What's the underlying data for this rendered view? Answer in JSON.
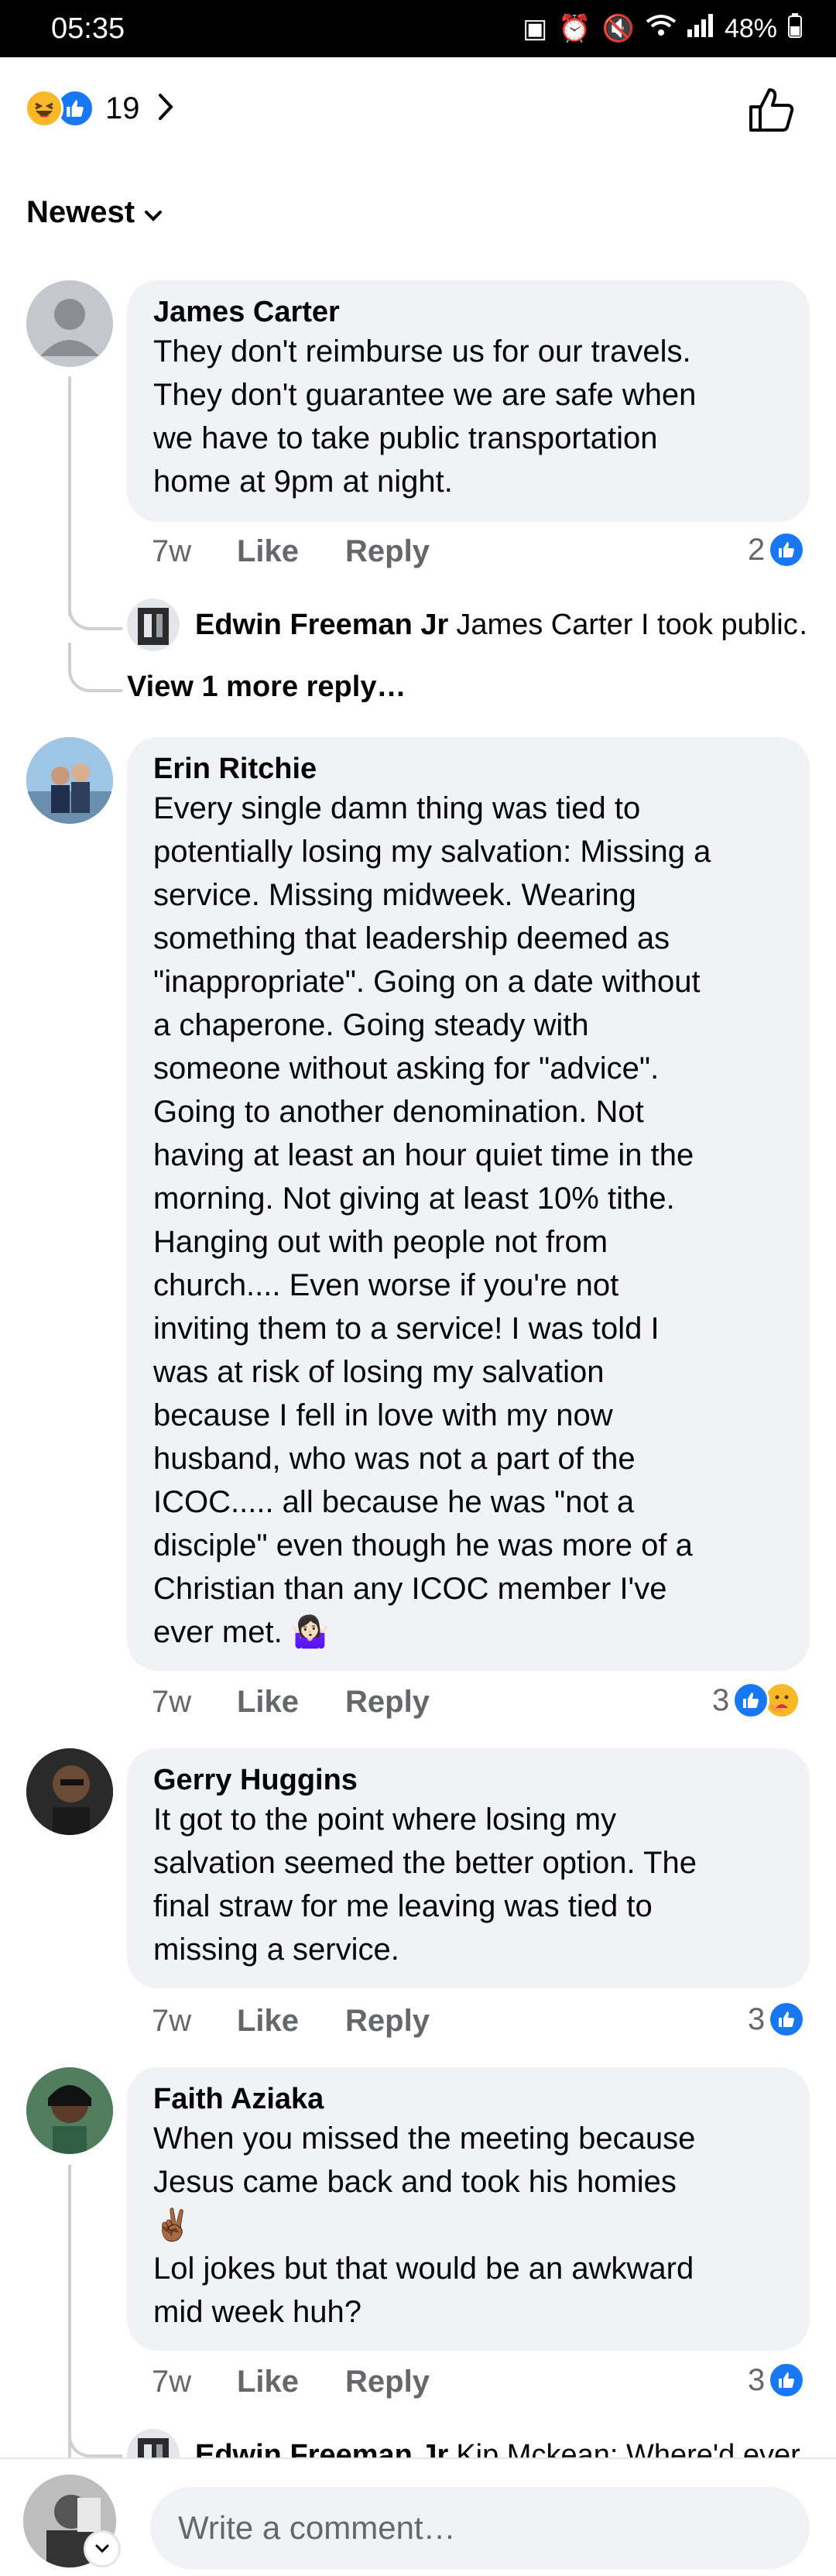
{
  "status_bar": {
    "time": "05:35",
    "battery": "48%"
  },
  "reactions_summary": {
    "count": "19"
  },
  "sort": {
    "label": "Newest"
  },
  "comments": [
    {
      "author": "James Carter",
      "text": "They don't reimburse us for our travels.\nThey don't guarantee we are safe when\nwe have to take public transportation\nhome at 9pm at night.",
      "time": "7w",
      "like_label": "Like",
      "reply_label": "Reply",
      "reaction_count": "2",
      "reply_preview": {
        "author": "Edwin Freeman Jr",
        "text": "James Carter I took public…"
      },
      "view_more": "View 1 more reply…"
    },
    {
      "author": "Erin Ritchie",
      "text": "Every single damn thing was tied to\npotentially losing my salvation: Missing a\nservice. Missing midweek. Wearing\nsomething that leadership deemed as\n\"inappropriate\". Going on a date without\na chaperone. Going steady with\nsomeone without asking for \"advice\".\nGoing to another denomination. Not\nhaving at least an hour quiet time in the\nmorning. Not giving at least 10% tithe.\nHanging out with people not from\nchurch.... Even worse if you're not\ninviting them to a service! I was told I\nwas at risk of losing my salvation\nbecause I fell in love with my now\nhusband, who was not a part of the\nICOC..... all because he was \"not a\ndisciple\" even though he was more of a\nChristian than any ICOC member I've\never met. 🤷🏻‍♀️",
      "time": "7w",
      "like_label": "Like",
      "reply_label": "Reply",
      "reaction_count": "3"
    },
    {
      "author": "Gerry Huggins",
      "text": "It got to the point where losing my\nsalvation seemed the better option. The\nfinal straw for me leaving was tied to\nmissing a service.",
      "time": "7w",
      "like_label": "Like",
      "reply_label": "Reply",
      "reaction_count": "3"
    },
    {
      "author": "Faith Aziaka",
      "text": "When you missed the meeting because\nJesus came back and took his homies\n✌🏾\nLol jokes but that would be an awkward\nmid week huh?",
      "time": "7w",
      "like_label": "Like",
      "reply_label": "Reply",
      "reaction_count": "3",
      "reply_preview": {
        "author": "Edwin Freeman Jr",
        "text": "Kip Mckean:  Where'd ever…"
      }
    }
  ],
  "composer": {
    "placeholder": "Write a comment…"
  },
  "colors": {
    "like_blue": "#1877f2",
    "bubble_gray": "#f0f2f5",
    "meta_gray": "#65676b"
  },
  "icons": [
    "haha-icon",
    "like-icon",
    "care-icon",
    "thumbs-up-icon",
    "chevron-right-icon",
    "chevron-down-icon"
  ]
}
